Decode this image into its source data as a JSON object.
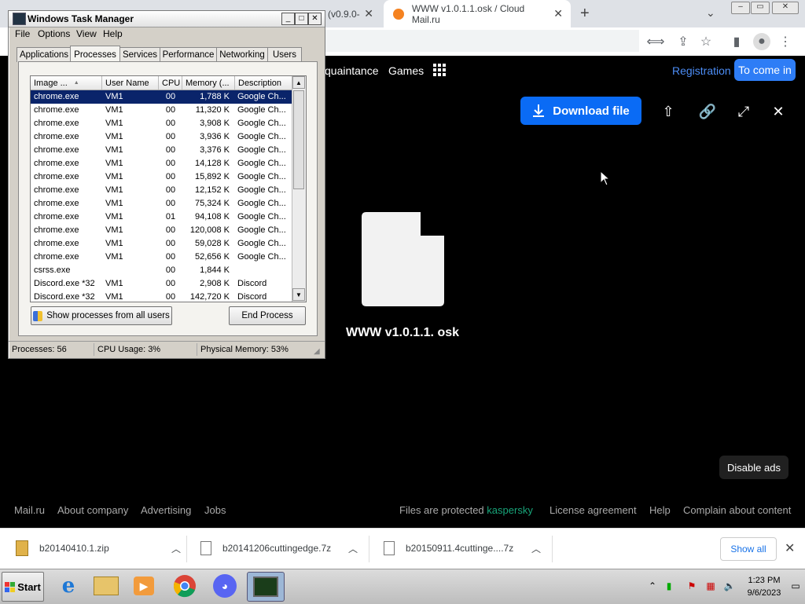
{
  "browser": {
    "tabs": [
      {
        "label": "(v0.9.0-"
      },
      {
        "label": "WWW v1.0.1.1.osk / Cloud Mail.ru"
      }
    ],
    "new_tab": "+",
    "window_buttons": [
      "–",
      "▭",
      "✕"
    ]
  },
  "site": {
    "nav": [
      "quaintance",
      "Games"
    ],
    "registration": "Registration",
    "come_in": "To come in",
    "download_label": "Download file",
    "file_name": "WWW v1.0.1.1. osk",
    "disable_ads": "Disable ads",
    "footer_left": [
      "Mail.ru",
      "About company",
      "Advertising",
      "Jobs"
    ],
    "protected_text": "Files are protected",
    "kaspersky": "kaspersky",
    "footer_right": [
      "License agreement",
      "Help",
      "Complain about content"
    ]
  },
  "downloads": {
    "items": [
      "b20140410.1.zip",
      "b20141206cuttingedge.7z",
      "b20150911.4cuttinge....7z"
    ],
    "show_all": "Show all"
  },
  "taskbar": {
    "start": "Start",
    "time": "1:23 PM",
    "date": "9/6/2023"
  },
  "taskmgr": {
    "title": "Windows Task Manager",
    "menu": [
      "File",
      "Options",
      "View",
      "Help"
    ],
    "tabs": [
      "Applications",
      "Processes",
      "Services",
      "Performance",
      "Networking",
      "Users"
    ],
    "columns": [
      "Image ...",
      "User Name",
      "CPU",
      "Memory (...",
      "Description"
    ],
    "rows": [
      [
        "chrome.exe",
        "VM1",
        "00",
        "1,788 K",
        "Google Ch..."
      ],
      [
        "chrome.exe",
        "VM1",
        "00",
        "11,320 K",
        "Google Ch..."
      ],
      [
        "chrome.exe",
        "VM1",
        "00",
        "3,908 K",
        "Google Ch..."
      ],
      [
        "chrome.exe",
        "VM1",
        "00",
        "3,936 K",
        "Google Ch..."
      ],
      [
        "chrome.exe",
        "VM1",
        "00",
        "3,376 K",
        "Google Ch..."
      ],
      [
        "chrome.exe",
        "VM1",
        "00",
        "14,128 K",
        "Google Ch..."
      ],
      [
        "chrome.exe",
        "VM1",
        "00",
        "15,892 K",
        "Google Ch..."
      ],
      [
        "chrome.exe",
        "VM1",
        "00",
        "12,152 K",
        "Google Ch..."
      ],
      [
        "chrome.exe",
        "VM1",
        "00",
        "75,324 K",
        "Google Ch..."
      ],
      [
        "chrome.exe",
        "VM1",
        "01",
        "94,108 K",
        "Google Ch..."
      ],
      [
        "chrome.exe",
        "VM1",
        "00",
        "120,008 K",
        "Google Ch..."
      ],
      [
        "chrome.exe",
        "VM1",
        "00",
        "59,028 K",
        "Google Ch..."
      ],
      [
        "chrome.exe",
        "VM1",
        "00",
        "52,656 K",
        "Google Ch..."
      ],
      [
        "csrss.exe",
        "",
        "00",
        "1,844 K",
        ""
      ],
      [
        "Discord.exe *32",
        "VM1",
        "00",
        "2,908 K",
        "Discord"
      ],
      [
        "Discord.exe *32",
        "VM1",
        "00",
        "142,720 K",
        "Discord"
      ]
    ],
    "show_all_btn": "Show processes from all users",
    "end_btn": "End Process",
    "status": {
      "processes": "Processes: 56",
      "cpu": "CPU Usage: 3%",
      "memory": "Physical Memory: 53%"
    }
  },
  "colors": {
    "accent_blue": "#0a6bf5",
    "selection": "#0a246a",
    "kaspersky_green": "#18a57a"
  }
}
